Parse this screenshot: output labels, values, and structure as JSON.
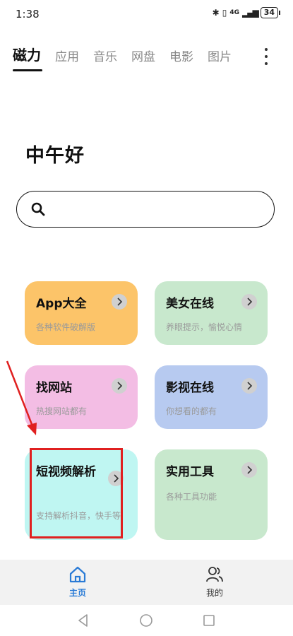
{
  "status_bar": {
    "time": "1:38",
    "network": "4G",
    "battery": "34"
  },
  "tabs": [
    {
      "label": "磁力",
      "active": true
    },
    {
      "label": "应用"
    },
    {
      "label": "音乐"
    },
    {
      "label": "网盘"
    },
    {
      "label": "电影"
    },
    {
      "label": "图片"
    }
  ],
  "greeting": "中午好",
  "search": {
    "value": "",
    "placeholder": ""
  },
  "cards": [
    {
      "title": "App大全",
      "subtitle": "各种软件破解版",
      "color": "#fcc469"
    },
    {
      "title": "美女在线",
      "subtitle": "养眼提示，愉悦心情",
      "color": "#c8e8cd"
    },
    {
      "title": "找网站",
      "subtitle": "热搜网站都有",
      "color": "#f3bde4"
    },
    {
      "title": "影视在线",
      "subtitle": "你想看的都有",
      "color": "#b7caf0"
    },
    {
      "title": "短视频解析",
      "subtitle": "支持解析抖音，快手等",
      "color": "#bff6f2"
    },
    {
      "title": "实用工具",
      "subtitle": "各种工具功能",
      "color": "#c8e8cd"
    }
  ],
  "bottom_nav": [
    {
      "label": "主页",
      "icon": "home-icon",
      "active": true
    },
    {
      "label": "我的",
      "icon": "profile-icon"
    }
  ],
  "colors": {
    "accent": "#2a7bd6",
    "highlight": "#e02020"
  }
}
